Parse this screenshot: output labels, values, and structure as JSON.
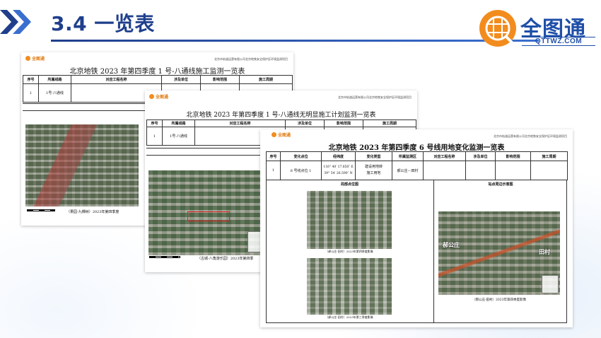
{
  "slide": {
    "title": "3.4 一览表",
    "logo_name": "全图通",
    "logo_url": "QTTWZ.COM",
    "accent": "#1f3f8c",
    "logo_orange": "#f28c1e"
  },
  "doc1": {
    "logo_text": "全图通",
    "org": "北京市轨道运营有限公司北京地铁安全保护区环境监测项目",
    "title": "北京地铁 2023 年第四季度 1 号-八通线施工监测一览表",
    "headers": [
      "序号",
      "所属线路",
      "对应工程名称",
      "涉及单位",
      "影响范围",
      "施工周期"
    ],
    "row": [
      "1",
      "1号-八通线",
      "",
      "",
      "",
      ""
    ],
    "section": "局部点位图",
    "caption": "（果园-九棵树）2023年第四季度"
  },
  "doc2": {
    "logo_text": "全图通",
    "org": "北京市轨道运营有限公司北京地铁安全保护区环境监测项目",
    "title": "北京地铁 2023 年第四季度 1 号-八通线无明显施工计划监测一览表",
    "headers": [
      "序号",
      "所属线路",
      "对应工程名称",
      "涉及单位",
      "影响范围",
      "施工周期"
    ],
    "row": [
      "1",
      "1号-八通线",
      "",
      "",
      "",
      ""
    ],
    "section": "局部点位图",
    "caption": "（古城-八角游乐园）2023年第四季"
  },
  "doc3": {
    "logo_text": "全图通",
    "org": "北京市轨道运营有限公司北京地铁安全保护区环境监测项目",
    "title": "北京地铁 2023 年第四季度 6 号线用地变化监测一览表",
    "headers": [
      "序号",
      "变化点位",
      "经纬度",
      "变化类型",
      "所属监测区",
      "对应工程名称",
      "涉及单位",
      "影响范围",
      "施工周期"
    ],
    "row": {
      "no": "1",
      "point": "6 号线点位 1",
      "lng": "116° 40′ 17.850″ E",
      "lat": "39° 54′ 26.590″ N",
      "type_1": "建设用地转",
      "type_2": "施工用地",
      "zone": "郝公庄—田村"
    },
    "section_left": "局部点位图",
    "section_right": "站点周边示意图",
    "caption_top": "（郝公庄-田村）2023年第四季度影像",
    "caption_bottom": "（郝公庄-田村）2023年第三季度影像",
    "caption_right": "（郝公庄-田村）2023年第四季度影像",
    "map_label_left": "郝公庄",
    "map_label_right": "田村"
  }
}
